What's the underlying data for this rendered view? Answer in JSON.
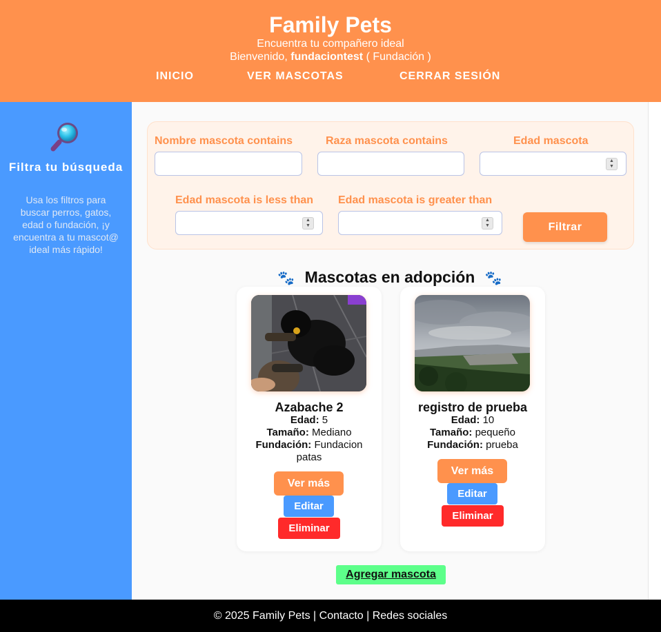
{
  "header": {
    "title": "Family Pets",
    "subtitle": "Encuentra tu compañero ideal",
    "welcome_prefix": "Bienvenido,",
    "username": "fundaciontest",
    "role": "( Fundación )"
  },
  "nav": {
    "items": [
      {
        "label": "INICIO"
      },
      {
        "label": "VER MASCOTAS"
      },
      {
        "label": "CERRAR SESIÓN"
      }
    ]
  },
  "sidebar": {
    "icon": "magnifying-glass-icon",
    "title": "Filtra tu búsqueda",
    "text": "Usa los filtros para buscar perros, gatos, edad o fundación, ¡y encuentra a tu mascot@ ideal más rápido!"
  },
  "filters": {
    "nombre_label": "Nombre mascota contains",
    "raza_label": "Raza mascota contains",
    "edad_label": "Edad mascota",
    "edad_lt_label": "Edad mascota is less than",
    "edad_gt_label": "Edad mascota is greater than",
    "submit_label": "Filtrar"
  },
  "pets_section": {
    "title": "Mascotas en adopción",
    "paw_icon": "🐾",
    "pets": [
      {
        "name": "Azabache 2",
        "edad_label": "Edad:",
        "edad": "5",
        "tamano_label": "Tamaño:",
        "tamano": "Mediano",
        "fundacion_label": "Fundación:",
        "fundacion": "Fundacion patas",
        "photo": "black-dog-photo"
      },
      {
        "name": "registro de prueba",
        "edad_label": "Edad:",
        "edad": "10",
        "tamano_label": "Tamaño:",
        "tamano": "pequeño",
        "fundacion_label": "Fundación:",
        "fundacion": "prueba",
        "photo": "landscape-photo"
      }
    ],
    "ver_mas_label": "Ver más",
    "editar_label": "Editar",
    "eliminar_label": "Eliminar"
  },
  "add_button": "Agregar mascota",
  "footer": {
    "text": "© 2025 Family Pets | Contacto | Redes sociales"
  },
  "colors": {
    "orange": "#ff914d",
    "blue": "#4a9aff",
    "red": "#ff2a2a",
    "green": "#5dff8a"
  }
}
